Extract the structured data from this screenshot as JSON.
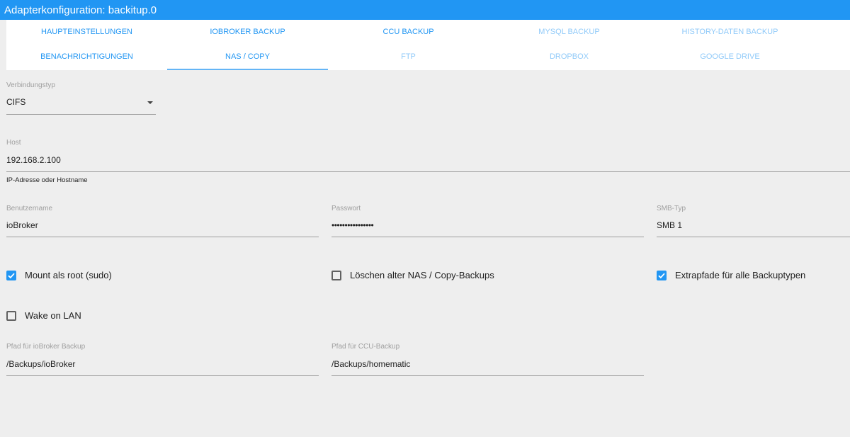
{
  "window": {
    "title": "Adapterkonfiguration: backitup.0"
  },
  "tabs": [
    {
      "label": "Haupteinstellungen",
      "state": "enabled"
    },
    {
      "label": "ioBroker Backup",
      "state": "enabled"
    },
    {
      "label": "CCU Backup",
      "state": "enabled"
    },
    {
      "label": "MySQL Backup",
      "state": "disabled"
    },
    {
      "label": "History-Daten Backup",
      "state": "disabled"
    },
    {
      "label": "Benachrichtigungen",
      "state": "enabled"
    },
    {
      "label": "NAS / Copy",
      "state": "active"
    },
    {
      "label": "FTP",
      "state": "disabled"
    },
    {
      "label": "Dropbox",
      "state": "disabled"
    },
    {
      "label": "Google Drive",
      "state": "disabled"
    }
  ],
  "form": {
    "connection_type": {
      "label": "Verbindungstyp",
      "value": "CIFS"
    },
    "host": {
      "label": "Host",
      "value": "192.168.2.100",
      "helper": "IP-Adresse oder Hostname"
    },
    "username": {
      "label": "Benutzername",
      "value": "ioBroker"
    },
    "password": {
      "label": "Passwort",
      "value": "••••••••••••••••"
    },
    "smb_type": {
      "label": "SMB-Typ",
      "value": "SMB 1"
    },
    "mount_root": {
      "label": "Mount als root (sudo)",
      "checked": true
    },
    "delete_old": {
      "label": "Löschen alter NAS / Copy-Backups",
      "checked": false
    },
    "extra_paths": {
      "label": "Extrapfade für alle Backuptypen",
      "checked": true
    },
    "wake_on_lan": {
      "label": "Wake on LAN",
      "checked": false
    },
    "path_iobroker": {
      "label": "Pfad für ioBroker Backup",
      "value": "/Backups/ioBroker"
    },
    "path_ccu": {
      "label": "Pfad für CCU-Backup",
      "value": "/Backups/homematic"
    }
  },
  "colors": {
    "accent": "#2196f3",
    "tab_disabled": "#90caf9",
    "background": "#eeeeee"
  }
}
